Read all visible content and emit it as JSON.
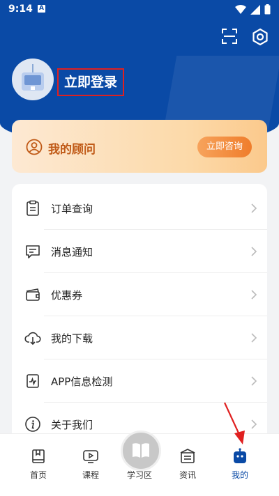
{
  "status_bar": {
    "time": "9:14",
    "notification_letter": "A"
  },
  "header": {
    "login_label": "立即登录"
  },
  "advisor": {
    "title": "我的顾问",
    "button_label": "立即咨询"
  },
  "menu": {
    "items": [
      {
        "label": "订单查询",
        "icon": "clipboard-icon"
      },
      {
        "label": "消息通知",
        "icon": "message-icon"
      },
      {
        "label": "优惠券",
        "icon": "coupon-icon"
      },
      {
        "label": "我的下载",
        "icon": "cloud-download-icon"
      },
      {
        "label": "APP信息检测",
        "icon": "monitor-icon"
      },
      {
        "label": "关于我们",
        "icon": "info-icon"
      }
    ]
  },
  "bottom_nav": {
    "items": [
      {
        "label": "首页",
        "icon": "book-icon"
      },
      {
        "label": "课程",
        "icon": "play-icon"
      },
      {
        "label": "学习区",
        "icon": "open-book-icon"
      },
      {
        "label": "资讯",
        "icon": "news-icon"
      },
      {
        "label": "我的",
        "icon": "robot-icon",
        "active": true
      }
    ]
  },
  "colors": {
    "brand_blue": "#0a4aa6",
    "accent_orange": "#ef7d2b",
    "annotation_red": "#e02020"
  }
}
